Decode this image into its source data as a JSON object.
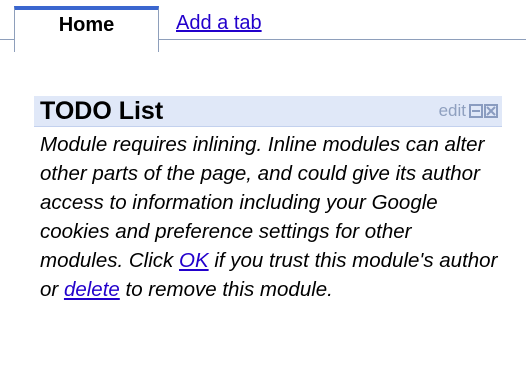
{
  "tabs": {
    "home_label": "Home",
    "add_label": "Add a tab"
  },
  "module": {
    "title": "TODO List",
    "edit_label": "edit",
    "icons": {
      "minimize": "minimize-icon",
      "close": "close-icon"
    },
    "message_part1": "Module requires inlining. Inline modules can alter other parts of the page, and could give its author access to information including your Google cookies and preference settings for other modules. Click ",
    "ok_link": "OK",
    "message_part2": " if you trust this module's author or ",
    "delete_link": "delete",
    "message_part3": " to remove this module."
  },
  "colors": {
    "tab_accent": "#3a66cf",
    "link": "#2200cc",
    "header_bg": "#e0e8f8",
    "control_grey": "#8a9cc0"
  }
}
